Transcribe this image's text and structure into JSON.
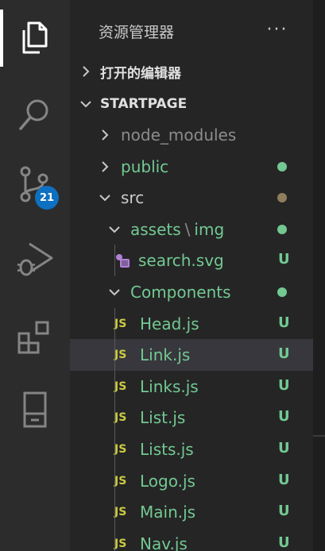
{
  "activity_bar": {
    "items": [
      {
        "icon": "explorer-icon",
        "active": true
      },
      {
        "icon": "search-icon"
      },
      {
        "icon": "source-control-icon",
        "badge": "21"
      },
      {
        "icon": "run-debug-icon"
      },
      {
        "icon": "extensions-icon"
      },
      {
        "icon": "remote-explorer-icon"
      }
    ],
    "colors": {
      "bg": "#2c2c2c",
      "icon": "#858585",
      "active_icon": "#ffffff",
      "badge": "#0e70c0"
    }
  },
  "sidebar": {
    "title": "资源管理器",
    "more": "···",
    "open_editors": "打开的编辑器",
    "workspace": "STARTPAGE"
  },
  "tree": [
    {
      "label": "node_modules",
      "type": "folder",
      "expanded": false,
      "depth": 1,
      "color": "gray"
    },
    {
      "label": "public",
      "type": "folder",
      "expanded": false,
      "depth": 1,
      "color": "green",
      "dot": "#73c991"
    },
    {
      "label": "src",
      "type": "folder",
      "expanded": true,
      "depth": 1,
      "color": "white",
      "dot": "#8e7e5b"
    },
    {
      "label": "assets",
      "label_sep": "\\",
      "label_tail": "img",
      "type": "folder",
      "expanded": true,
      "depth": 2,
      "color": "green",
      "dot": "#73c991"
    },
    {
      "label": "search.svg",
      "type": "svg",
      "depth": 3,
      "color": "green",
      "status": "U"
    },
    {
      "label": "Components",
      "type": "folder",
      "expanded": true,
      "depth": 2,
      "color": "green",
      "dot": "#73c991"
    },
    {
      "label": "Head.js",
      "type": "js",
      "depth": 3,
      "color": "green",
      "status": "U"
    },
    {
      "label": "Link.js",
      "type": "js",
      "depth": 3,
      "color": "green",
      "status": "U",
      "selected": true
    },
    {
      "label": "Links.js",
      "type": "js",
      "depth": 3,
      "color": "green",
      "status": "U"
    },
    {
      "label": "List.js",
      "type": "js",
      "depth": 3,
      "color": "green",
      "status": "U"
    },
    {
      "label": "Lists.js",
      "type": "js",
      "depth": 3,
      "color": "green",
      "status": "U"
    },
    {
      "label": "Logo.js",
      "type": "js",
      "depth": 3,
      "color": "green",
      "status": "U"
    },
    {
      "label": "Main.js",
      "type": "js",
      "depth": 3,
      "color": "green",
      "status": "U"
    },
    {
      "label": "Nav.js",
      "type": "js",
      "depth": 3,
      "color": "green",
      "status": "U"
    }
  ],
  "js_badge": "JS",
  "colors": {
    "untracked": "#73c991",
    "selected_bg": "#37373d",
    "sidebar_bg": "#252526"
  }
}
